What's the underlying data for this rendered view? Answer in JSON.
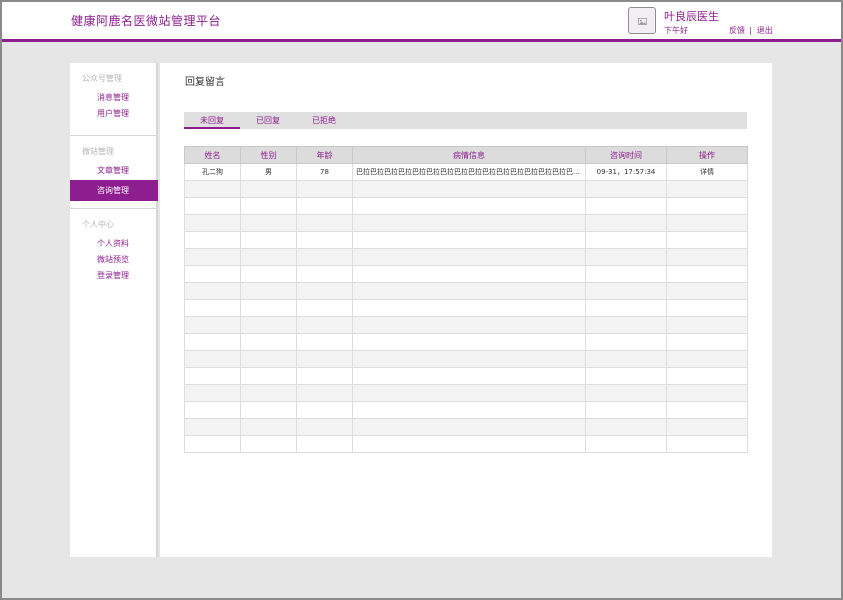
{
  "header": {
    "title": "健康阿鹿名医微站管理平台",
    "avatar_icon": "image-placeholder-icon",
    "doctor_name": "叶良辰医生",
    "greeting": "下午好",
    "feedback": "反馈",
    "separator": "|",
    "logout": "退出"
  },
  "sidebar": {
    "groups": [
      {
        "title": "公众号管理",
        "items": [
          {
            "label": "消息管理"
          },
          {
            "label": "用户管理"
          }
        ]
      },
      {
        "title": "微站管理",
        "items": [
          {
            "label": "文章管理"
          },
          {
            "label": "咨询管理",
            "active": true
          }
        ]
      },
      {
        "title": "个人中心",
        "items": [
          {
            "label": "个人资料"
          },
          {
            "label": "微站预览"
          },
          {
            "label": "登录管理"
          }
        ]
      }
    ]
  },
  "main": {
    "title": "回复留言",
    "tabs": [
      {
        "label": "未回复",
        "active": true
      },
      {
        "label": "已回复"
      },
      {
        "label": "已拒绝"
      }
    ],
    "table": {
      "columns": [
        "姓名",
        "性别",
        "年龄",
        "病情信息",
        "咨询时间",
        "操作"
      ],
      "rows": [
        [
          "孔二狗",
          "男",
          "78",
          "巴拉巴拉巴拉巴拉巴拉巴拉巴拉巴拉巴拉巴拉巴拉巴拉巴拉巴拉巴拉巴拉 [图片]...",
          "09-31，17:57:34",
          "详情"
        ]
      ],
      "empty_rows": 16
    }
  },
  "colors": {
    "accent": "#8e1d8f",
    "page_bg": "#e6e6e6",
    "table_header_bg": "#dcdcdc"
  }
}
